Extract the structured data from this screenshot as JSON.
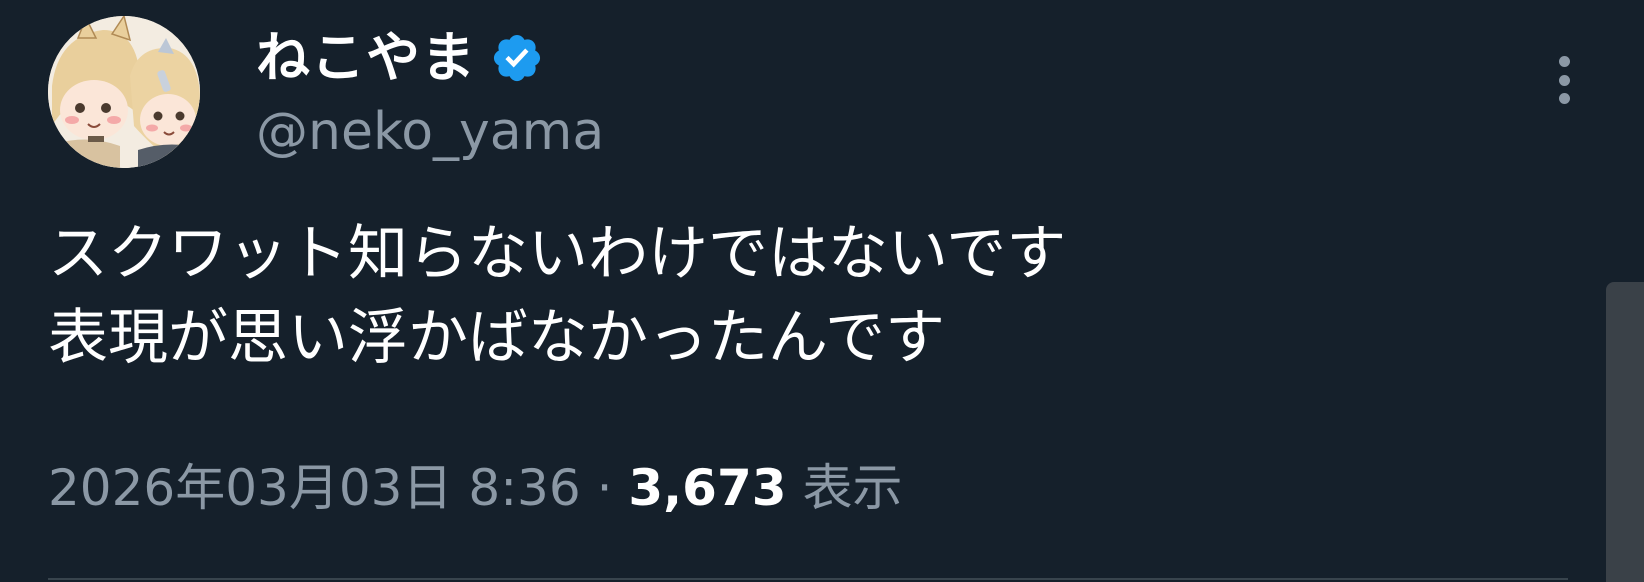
{
  "author": {
    "display_name": "ねこやま",
    "handle": "@neko_yama",
    "verified": true,
    "avatar_icon": "avatar-illustration-icon",
    "verified_icon": "verified-badge-icon"
  },
  "tweet": {
    "lines": [
      "スクワット知らないわけではないです",
      "表現が思い浮かばなかったんです"
    ]
  },
  "meta": {
    "timestamp": "2026年03月03日 8:36",
    "separator": "·",
    "views_count": "3,673",
    "views_label": "表示"
  },
  "actions": {
    "more_icon": "more-options-icon"
  },
  "colors": {
    "background": "#15202b",
    "text_primary": "#ffffff",
    "text_secondary": "#8b98a5",
    "verified_blue": "#1d9bf0",
    "divider": "#38444d"
  }
}
